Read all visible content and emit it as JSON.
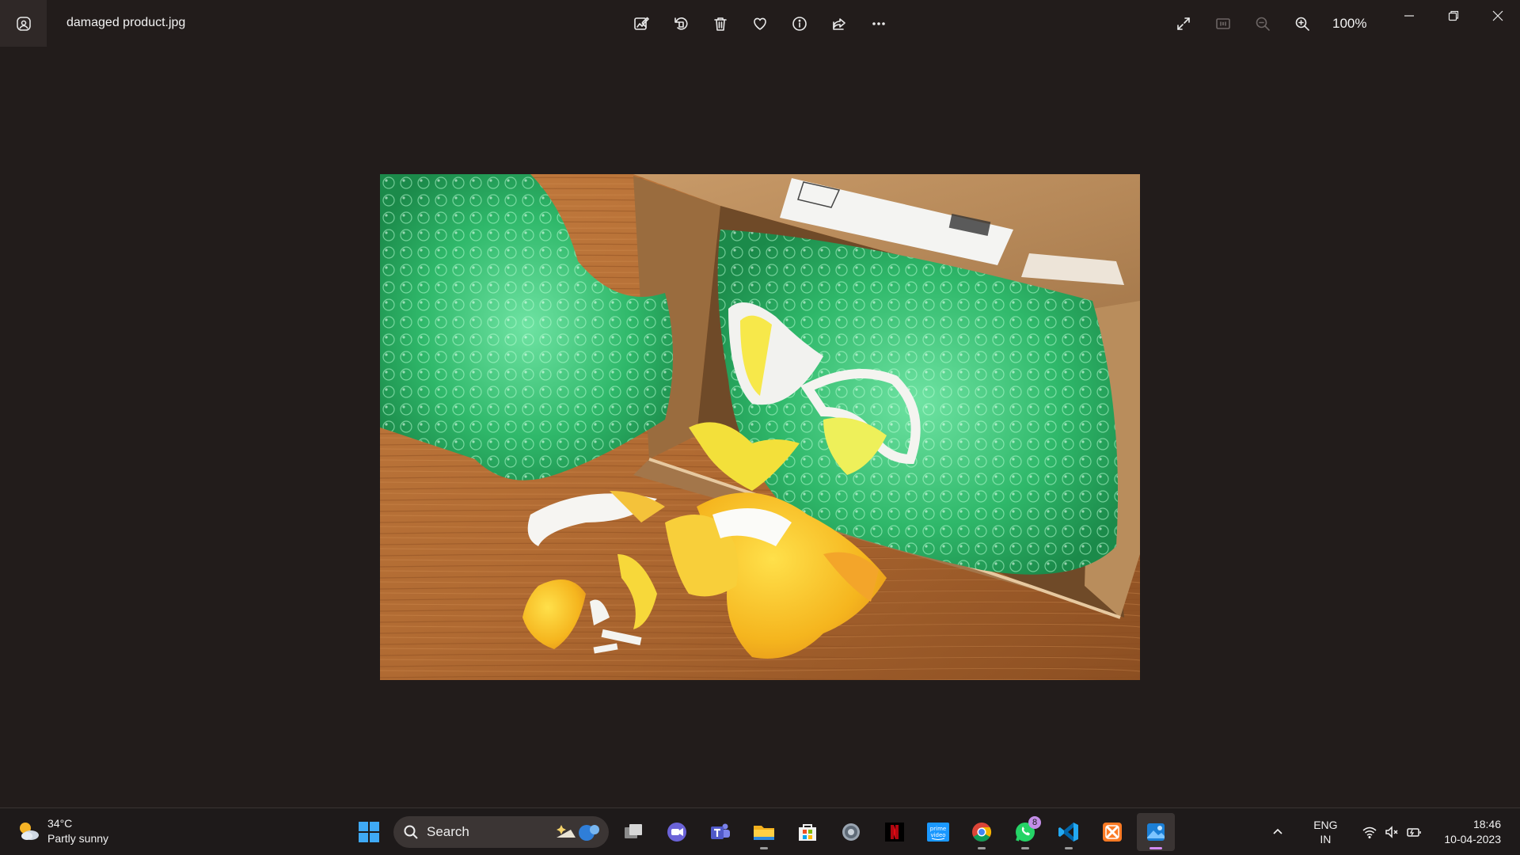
{
  "window": {
    "file_name": "damaged product.jpg",
    "zoom": "100%",
    "toolbar": [
      "edit-image",
      "rotate",
      "delete",
      "favorite",
      "file-info",
      "share",
      "more"
    ]
  },
  "photo": {
    "subject": "damaged product"
  },
  "taskbar": {
    "weather": {
      "temp": "34°C",
      "condition": "Partly sunny"
    },
    "search_label": "Search",
    "whatsapp_badge": "8",
    "lang_line1": "ENG",
    "lang_line2": "IN",
    "time": "18:46",
    "date": "10-04-2023"
  }
}
